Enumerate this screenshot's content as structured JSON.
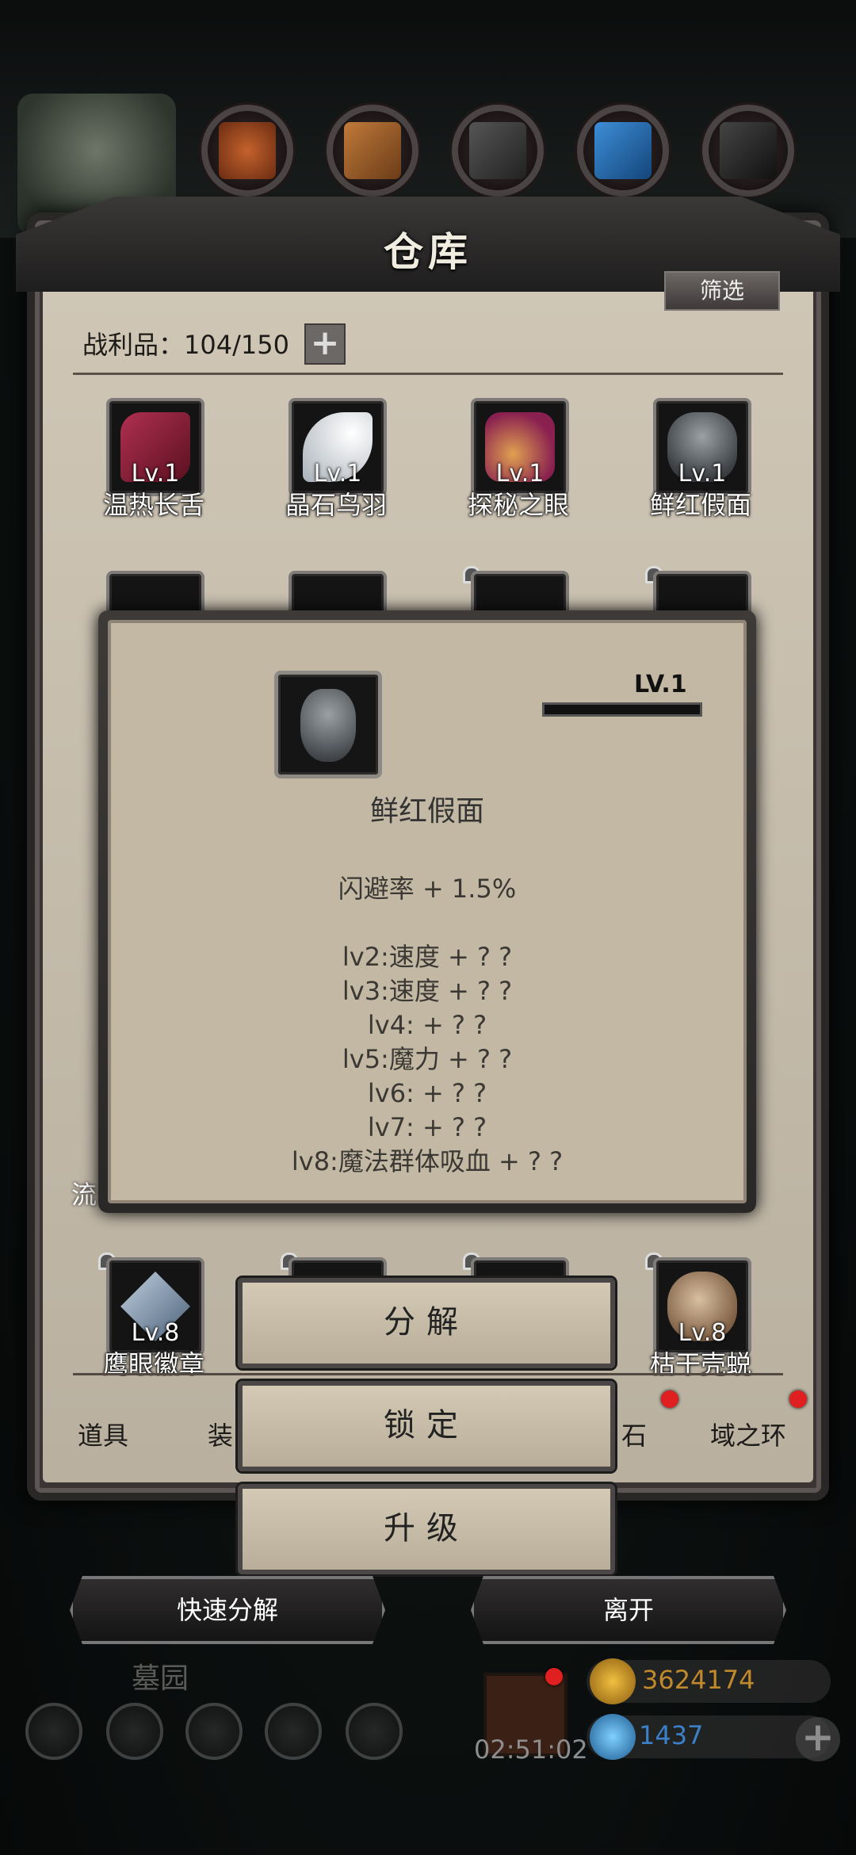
{
  "header": {
    "title": "仓库",
    "filter_label": "筛选",
    "loot_label": "战利品：104/150",
    "plus_label": "+"
  },
  "items_row1": [
    {
      "lv": "Lv.1",
      "name": "温热长舌"
    },
    {
      "lv": "Lv.1",
      "name": "晶石鸟羽"
    },
    {
      "lv": "Lv.1",
      "name": "探秘之眼"
    },
    {
      "lv": "Lv.1",
      "name": "鲜红假面"
    }
  ],
  "items_bottom": [
    {
      "lv": "Lv.8",
      "name": "鹰眼徽章"
    },
    {
      "lv": "Lv.8",
      "name": "枯干壳蜕"
    }
  ],
  "partial_text": "流",
  "popup": {
    "lv": "LV.1",
    "name": "鲜红假面",
    "lines": [
      "闪避率 + 1.5%",
      "",
      "lv2:速度 + ? ?",
      "lv3:速度 + ? ?",
      "lv4: + ? ?",
      "lv5:魔力 + ? ?",
      "lv6: + ? ?",
      "lv7: + ? ?",
      "lv8:魔法群体吸血 + ? ?"
    ],
    "level_progress": 0
  },
  "actions": {
    "decompose": "分解",
    "lock": "锁定",
    "upgrade": "升级"
  },
  "tabs": {
    "items": "道具",
    "equip_partial": "装",
    "stone_partial": "石",
    "ring": "域之环"
  },
  "bottom_buttons": {
    "quick_decompose": "快速分解",
    "leave": "离开"
  },
  "hud": {
    "location": "墓园",
    "timer": "02:51:02",
    "gold": "3624174",
    "gems": "1437"
  },
  "colors": {
    "parchment": "#c2b8a4",
    "frame": "#3a3534",
    "notification_dot": "#e02020"
  }
}
